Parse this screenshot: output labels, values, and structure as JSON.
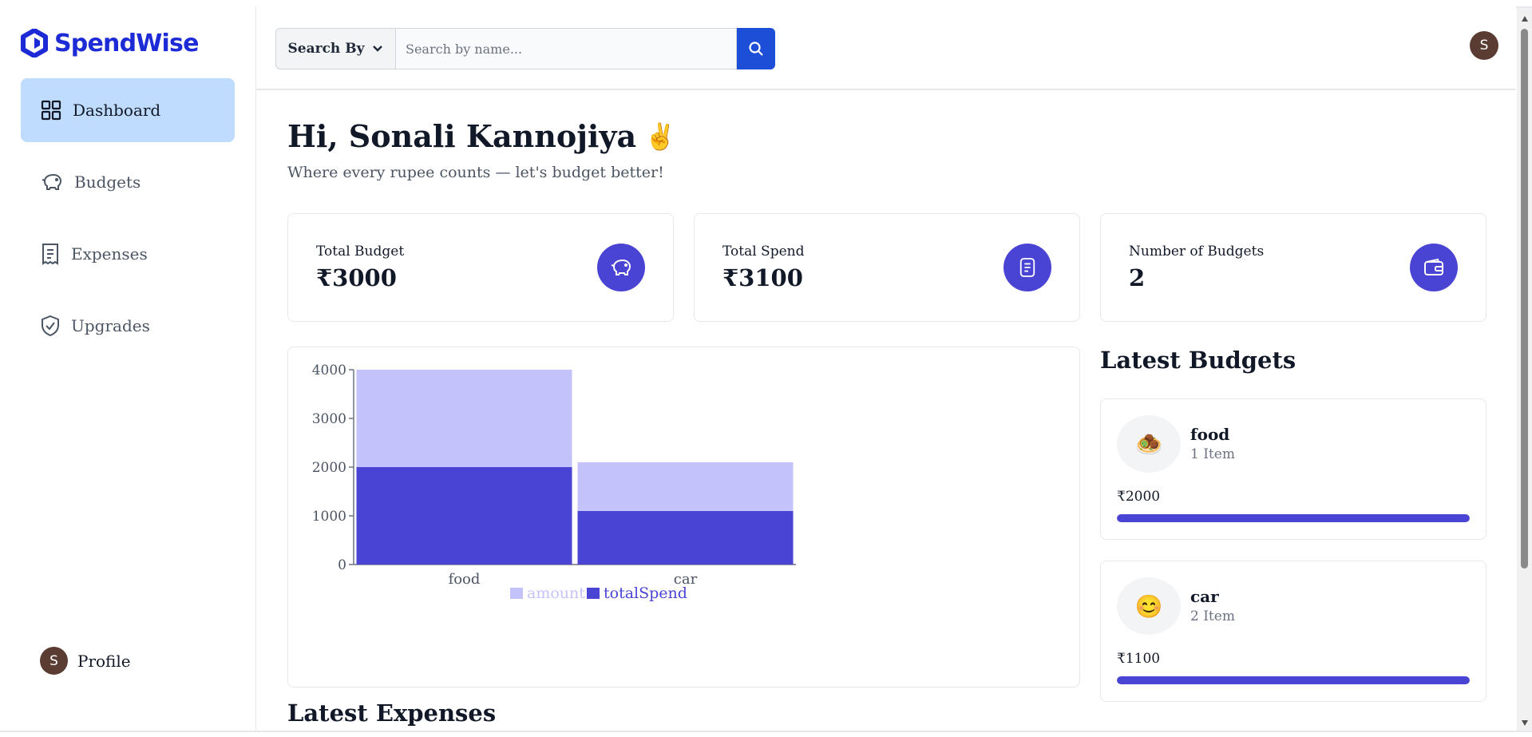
{
  "app": {
    "name": "SpendWise",
    "brand_color": "#1d2bd6",
    "accent_color": "#4a44d4"
  },
  "sidebar": {
    "items": [
      {
        "label": "Dashboard",
        "icon": "dashboard-grid-icon",
        "active": true
      },
      {
        "label": "Budgets",
        "icon": "piggy-bank-icon"
      },
      {
        "label": "Expenses",
        "icon": "receipt-icon"
      },
      {
        "label": "Upgrades",
        "icon": "shield-check-icon"
      }
    ],
    "profile": {
      "label": "Profile",
      "avatar_initial": "S"
    }
  },
  "header": {
    "search_by_label": "Search By",
    "search_placeholder": "Search by name...",
    "avatar_initial": "S"
  },
  "main": {
    "greeting": "Hi, Sonali Kannojiya",
    "greeting_emoji": "✌️",
    "subtitle": "Where every rupee counts — let's budget better!",
    "stats": [
      {
        "label": "Total Budget",
        "value": "₹3000",
        "icon": "piggy-bank-icon"
      },
      {
        "label": "Total Spend",
        "value": "₹3100",
        "icon": "receipt-icon"
      },
      {
        "label": "Number of Budgets",
        "value": "2",
        "icon": "wallet-icon"
      }
    ],
    "latest_budgets_title": "Latest Budgets",
    "latest_expenses_title": "Latest Expenses",
    "budgets": [
      {
        "emoji": "🧆",
        "name": "food",
        "items": "1 Item",
        "amount": "₹2000",
        "progress": 1.0
      },
      {
        "emoji": "😊",
        "name": "car",
        "items": "2 Item",
        "amount": "₹1100",
        "progress": 1.0
      }
    ]
  },
  "chart_data": {
    "type": "bar",
    "stacked": true,
    "categories": [
      "food",
      "car"
    ],
    "series": [
      {
        "name": "totalSpend",
        "values": [
          2000,
          1100
        ],
        "color": "#4a44d4"
      },
      {
        "name": "amount",
        "values": [
          2000,
          1000
        ],
        "color": "#c4c2fa"
      }
    ],
    "legend": [
      "amount",
      "totalSpend"
    ],
    "yticks": [
      0,
      1000,
      2000,
      3000,
      4000
    ],
    "ylim": [
      0,
      4000
    ],
    "legend_position": "bottom"
  }
}
